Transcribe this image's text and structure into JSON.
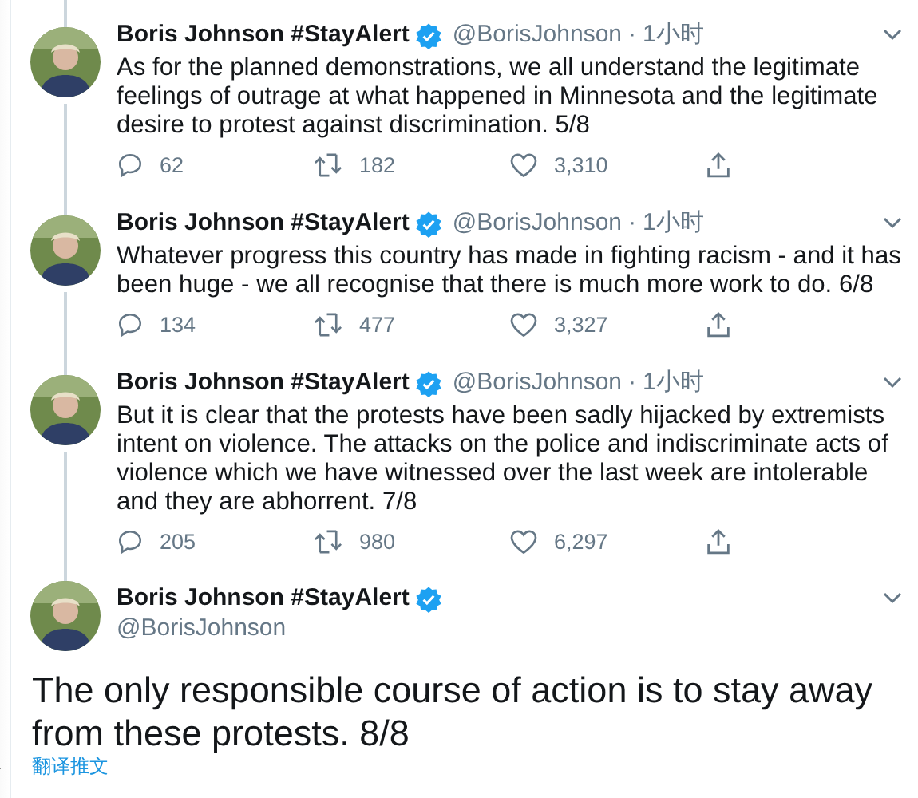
{
  "tweets": [
    {
      "kind": "reply",
      "author": "Boris Johnson #StayAlert",
      "verified": true,
      "handle": "@BorisJohnson",
      "dot": "·",
      "time": "1小时",
      "text": "As for the planned demonstrations, we all understand the legitimate feelings of outrage at what happened in Minnesota and the legitimate desire to protest against discrimination. 5/8",
      "replies": "62",
      "retweets": "182",
      "likes": "3,310"
    },
    {
      "kind": "reply",
      "author": "Boris Johnson #StayAlert",
      "verified": true,
      "handle": "@BorisJohnson",
      "dot": "·",
      "time": "1小时",
      "text": "Whatever progress this country has made in fighting racism - and it has been huge - we all recognise that there is much more work to do. 6/8",
      "replies": "134",
      "retweets": "477",
      "likes": "3,327"
    },
    {
      "kind": "reply",
      "author": "Boris Johnson #StayAlert",
      "verified": true,
      "handle": "@BorisJohnson",
      "dot": "·",
      "time": "1小时",
      "text": "But it is clear that the protests have been sadly hijacked by extremists intent on violence. The attacks on the police and indiscriminate acts of violence which we have witnessed over the last week are intolerable and they are abhorrent. 7/8",
      "replies": "205",
      "retweets": "980",
      "likes": "6,297"
    },
    {
      "kind": "focused",
      "author": "Boris Johnson #StayAlert",
      "verified": true,
      "handle": "@BorisJohnson",
      "text": "The only responsible course of action is to stay away from these protests. 8/8",
      "translate": "翻译推文"
    }
  ]
}
